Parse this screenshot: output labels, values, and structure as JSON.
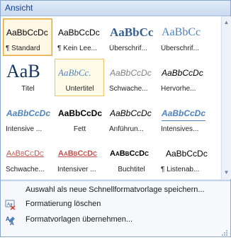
{
  "header": {
    "title": "Ansicht"
  },
  "gallery": {
    "tiles": [
      {
        "preview": "AaBbCcDc",
        "label": "¶ Standard",
        "state": "selected"
      },
      {
        "preview": "AaBbCcDc",
        "label": "¶ Kein Lee..."
      },
      {
        "preview": "AaBbCc",
        "label": "Überschrif..."
      },
      {
        "preview": "AaBbCc",
        "label": "Überschrif..."
      },
      {
        "preview": "AaB",
        "label": "Titel"
      },
      {
        "preview": "AaBbCc.",
        "label": "Untertitel",
        "state": "hover"
      },
      {
        "preview": "AaBbCcDc",
        "label": "Schwache..."
      },
      {
        "preview": "AaBbCcDc",
        "label": "Hervorhe..."
      },
      {
        "preview": "AaBbCcDc",
        "label": "Intensive ..."
      },
      {
        "preview": "AaBbCcDc",
        "label": "Fett"
      },
      {
        "preview": "AaBbCcDc",
        "label": "Anführun..."
      },
      {
        "preview": "AaBbCcDc",
        "label": "Intensives..."
      },
      {
        "preview": "AaBbCcDc",
        "label": "Schwache..."
      },
      {
        "preview": "AaBbCcDc",
        "label": "Intensiver ..."
      },
      {
        "preview": "AaBbCcDc",
        "label": "Buchtitel"
      },
      {
        "preview": "AaBbCcDc",
        "label": "¶ Listenab..."
      }
    ]
  },
  "menu": {
    "save_selection": "Auswahl als neue Schnellformatvorlage speichern...",
    "clear_formatting": "Formatierung löschen",
    "apply_styles": "Formatvorlagen übernehmen..."
  },
  "colors": {
    "heading": "#365f91",
    "accent": "#4f81bd",
    "subtle": "#808080",
    "red": "#c0504d",
    "selection_border": "#e3a33b"
  }
}
